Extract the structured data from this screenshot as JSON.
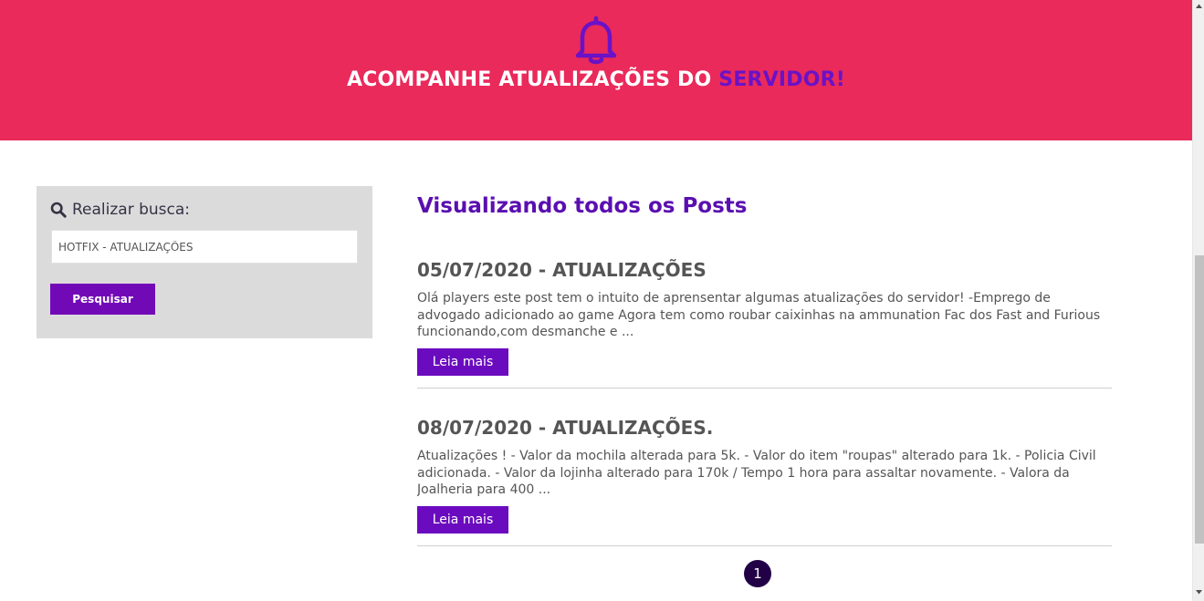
{
  "header": {
    "title_main": "ACOMPANHE ATUALIZAÇÕES DO ",
    "title_accent": "SERVIDOR!",
    "icon": "bell-icon",
    "background": "#ea2a5b",
    "accent_color": "#6a12c7"
  },
  "search": {
    "heading": "Realizar busca:",
    "input_value": "HOTFIX - ATUALIZAÇÕES",
    "button_label": "Pesquisar"
  },
  "main": {
    "title": "Visualizando todos os Posts",
    "posts": [
      {
        "title": "05/07/2020 - ATUALIZAÇÕES",
        "excerpt": "Olá players este post tem o intuito de aprensentar algumas atualizações do servidor! -Emprego de advogado adicionado ao game Agora tem como roubar caixinhas na ammunation Fac dos Fast and Furious funcionando,com desmanche e ...",
        "button": "Leia mais"
      },
      {
        "title": "08/07/2020 - ATUALIZAÇÕES.",
        "excerpt": "Atualizações ! - Valor da mochila alterada para 5k. - Valor do item \"roupas\" alterado para 1k. - Policia Civil adicionada. - Valor da lojinha alterado para 170k / Tempo 1 hora para assaltar novamente. - Valora da Joalheria para 400 ...",
        "button": "Leia mais"
      }
    ],
    "pagination": {
      "current_page": "1"
    }
  }
}
